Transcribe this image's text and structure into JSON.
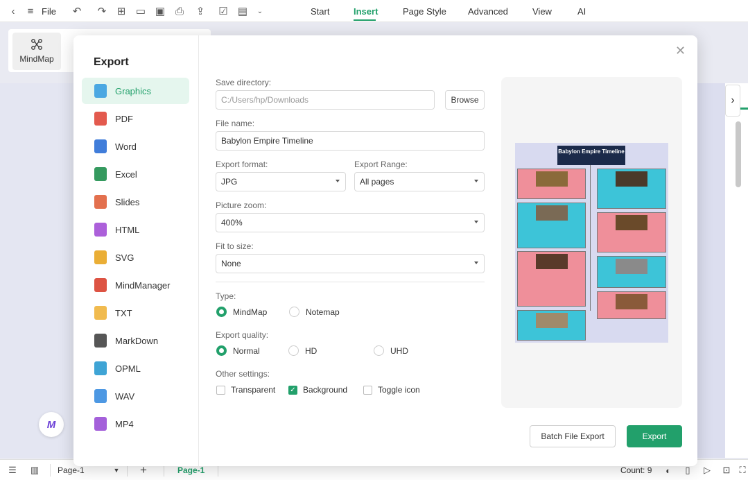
{
  "topbar": {
    "file_label": "File",
    "tabs": [
      {
        "label": "Start",
        "active": false
      },
      {
        "label": "Insert",
        "active": true
      },
      {
        "label": "Page Style",
        "active": false
      },
      {
        "label": "Advanced",
        "active": false
      },
      {
        "label": "View",
        "active": false
      },
      {
        "label": "AI",
        "active": false
      }
    ]
  },
  "ribbon": {
    "mindmap_label": "MindMap"
  },
  "dialog": {
    "title": "Export",
    "formats": [
      {
        "label": "Graphics",
        "color": "#3aa0e0",
        "active": true
      },
      {
        "label": "PDF",
        "color": "#e0483b",
        "active": false
      },
      {
        "label": "Word",
        "color": "#2b6fd6",
        "active": false
      },
      {
        "label": "Excel",
        "color": "#1f8f4e",
        "active": false
      },
      {
        "label": "Slides",
        "color": "#e0603b",
        "active": false
      },
      {
        "label": "HTML",
        "color": "#a34fd6",
        "active": false
      },
      {
        "label": "SVG",
        "color": "#e8a520",
        "active": false
      },
      {
        "label": "MindManager",
        "color": "#d9402f",
        "active": false
      },
      {
        "label": "TXT",
        "color": "#f0b43c",
        "active": false
      },
      {
        "label": "MarkDown",
        "color": "#444444",
        "active": false
      },
      {
        "label": "OPML",
        "color": "#2a9ad0",
        "active": false
      },
      {
        "label": "WAV",
        "color": "#3a8de0",
        "active": false
      },
      {
        "label": "MP4",
        "color": "#9a4fd6",
        "active": false
      }
    ],
    "save_directory_label": "Save directory:",
    "save_directory_value": "C:/Users/hp/Downloads",
    "browse_label": "Browse",
    "file_name_label": "File name:",
    "file_name_value": "Babylon Empire Timeline",
    "export_format_label": "Export format:",
    "export_format_value": "JPG",
    "export_range_label": "Export Range:",
    "export_range_value": "All pages",
    "picture_zoom_label": "Picture zoom:",
    "picture_zoom_value": "400%",
    "fit_to_size_label": "Fit to size:",
    "fit_to_size_value": "None",
    "type_label": "Type:",
    "type_options": [
      {
        "label": "MindMap",
        "selected": true
      },
      {
        "label": "Notemap",
        "selected": false
      }
    ],
    "quality_label": "Export quality:",
    "quality_options": [
      {
        "label": "Normal",
        "selected": true
      },
      {
        "label": "HD",
        "selected": false
      },
      {
        "label": "UHD",
        "selected": false
      }
    ],
    "other_settings_label": "Other settings:",
    "other_settings": [
      {
        "label": "Transparent",
        "checked": false
      },
      {
        "label": "Background",
        "checked": true
      },
      {
        "label": "Toggle icon",
        "checked": false
      }
    ],
    "preview_title": "Babylon Empire Timeline",
    "batch_label": "Batch File Export",
    "export_label": "Export"
  },
  "statusbar": {
    "page_select": "Page-1",
    "page_tab": "Page-1",
    "count": "Count: 9"
  },
  "colors": {
    "accent": "#22a06b"
  }
}
